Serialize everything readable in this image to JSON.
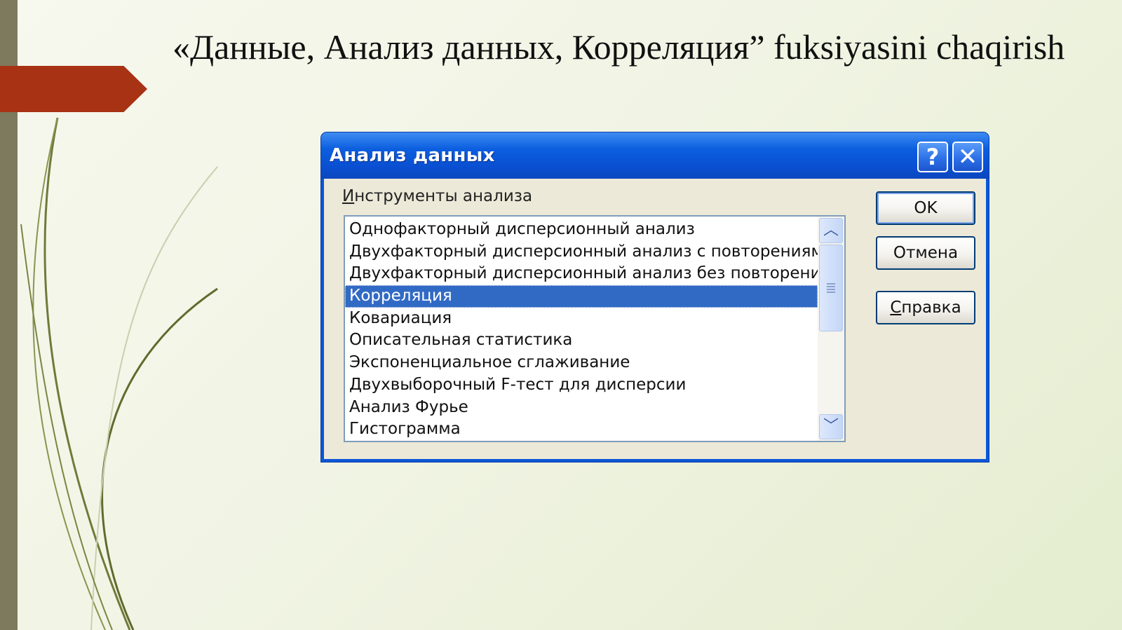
{
  "slide": {
    "title": "«Данные, Анализ данных, Корреляция” fuksiyasini chaqirish"
  },
  "dialog": {
    "title": "Анализ данных",
    "help_icon": "question-mark-icon",
    "close_icon": "close-x-icon",
    "tools_label_accel": "И",
    "tools_label_rest": "нструменты анализа",
    "list_items": [
      "Однофакторный дисперсионный анализ",
      "Двухфакторный дисперсионный анализ с повторениями",
      "Двухфакторный дисперсионный анализ без повторений",
      "Корреляция",
      "Ковариация",
      "Описательная статистика",
      "Экспоненциальное сглаживание",
      "Двухвыборочный F-тест для дисперсии",
      "Анализ Фурье",
      "Гистограмма"
    ],
    "selected_item": "Корреляция",
    "buttons": {
      "ok": "OK",
      "cancel": "Отмена",
      "help_accel": "С",
      "help_rest": "правка"
    }
  },
  "colors": {
    "accent_arrow": "#a83214",
    "left_bar": "#7d7a5e",
    "titlebar": "#0b56d7",
    "selection": "#316ac5"
  }
}
